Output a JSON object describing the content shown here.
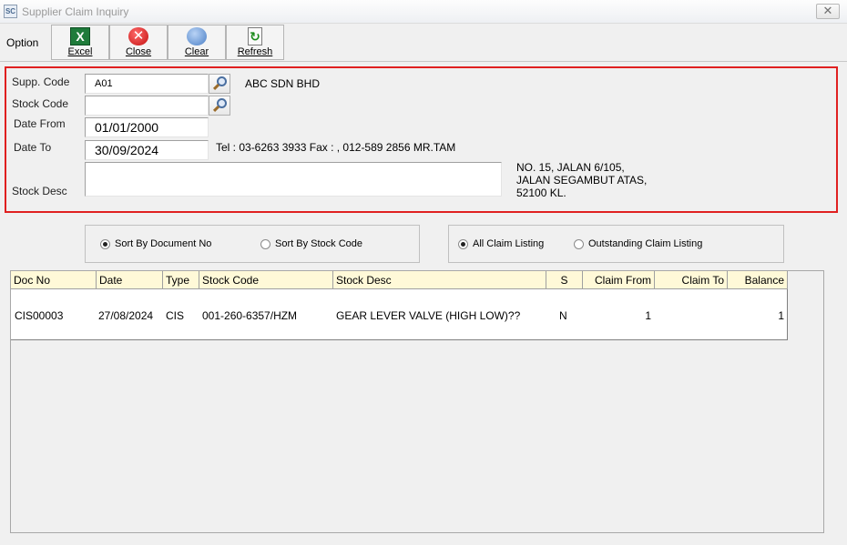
{
  "window": {
    "app_icon_text": "SC",
    "title": "Supplier Claim Inquiry",
    "close_glyph": "✕"
  },
  "toolbar": {
    "option_label": "Option",
    "buttons": [
      {
        "label": "Excel",
        "icon": "excel-icon",
        "glyph": "X"
      },
      {
        "label": "Close",
        "icon": "close-circle-icon",
        "glyph": "✕"
      },
      {
        "label": "Clear",
        "icon": "clear-icon",
        "glyph": ""
      },
      {
        "label": "Refresh",
        "icon": "refresh-icon",
        "glyph": "↻"
      }
    ]
  },
  "criteria": {
    "supp_code_label": "Supp. Code",
    "supp_code_value": "A01",
    "supp_name": "ABC SDN BHD",
    "stock_code_label": "Stock Code",
    "stock_code_value": "",
    "date_from_label": "Date From",
    "date_from_value": "01/01/2000",
    "date_to_label": "Date To",
    "date_to_value": "30/09/2024",
    "contact": "Tel : 03-6263 3933  Fax :   ,  012-589 2856 MR.TAM",
    "address": [
      "NO. 15, JALAN 6/105,",
      "JALAN SEGAMBUT ATAS,",
      "52100 KL."
    ],
    "stock_desc_label": "Stock Desc",
    "stock_desc_value": ""
  },
  "sort_options": {
    "by_document": "Sort By Document No",
    "by_stock": "Sort By Stock Code",
    "selected": "by_document"
  },
  "listing_options": {
    "all": "All Claim Listing",
    "outstanding": "Outstanding Claim Listing",
    "selected": "all"
  },
  "grid": {
    "columns": [
      "Doc No",
      "Date",
      "Type",
      "Stock Code",
      "Stock Desc",
      "S",
      "Claim From",
      "Claim To",
      "Balance"
    ],
    "rows": [
      {
        "doc_no": "CIS00003",
        "date": "27/08/2024",
        "type": "CIS",
        "stock_code": "001-260-6357/HZM",
        "stock_desc": "GEAR LEVER VALVE (HIGH LOW)??",
        "s": "N",
        "claim_from": "1",
        "claim_to": "",
        "balance": "1"
      }
    ]
  },
  "colors": {
    "highlight_border": "#e02020",
    "header_bg": "#fff9d8"
  }
}
